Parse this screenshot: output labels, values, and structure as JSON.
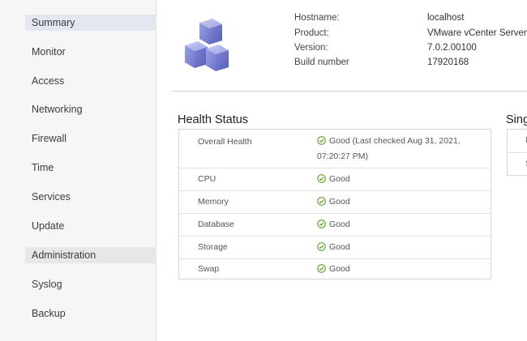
{
  "sidebar": {
    "items": [
      {
        "label": "Summary"
      },
      {
        "label": "Monitor"
      },
      {
        "label": "Access"
      },
      {
        "label": "Networking"
      },
      {
        "label": "Firewall"
      },
      {
        "label": "Time"
      },
      {
        "label": "Services"
      },
      {
        "label": "Update"
      },
      {
        "label": "Administration"
      },
      {
        "label": "Syslog"
      },
      {
        "label": "Backup"
      }
    ],
    "active": "Summary"
  },
  "summary": {
    "logo_icon": "vcenter-cubes-icon",
    "hostname_label": "Hostname:",
    "hostname_value": "localhost",
    "product_label": "Product:",
    "product_value": "VMware vCenter Server",
    "version_label": "Version:",
    "version_value": "7.0.2.00100",
    "build_label": "Build number",
    "build_value": "17920168"
  },
  "health": {
    "title": "Health Status",
    "status_icon": "check-circle-icon",
    "status_color": "#5aa220",
    "rows": [
      {
        "label": "Overall Health",
        "value_line1": "Good (Last checked Aug 31, 2021,",
        "value_line2": "07:20:27 PM)"
      },
      {
        "label": "CPU",
        "value": "Good"
      },
      {
        "label": "Memory",
        "value": "Good"
      },
      {
        "label": "Database",
        "value": "Good"
      },
      {
        "label": "Storage",
        "value": "Good"
      },
      {
        "label": "Swap",
        "value": "Good"
      }
    ]
  },
  "sso": {
    "title_partial": "Sing",
    "row1_partial": "I",
    "row2_partial": "S"
  },
  "colors": {
    "sidebar_bg": "#f6f6f6",
    "active_item_bg": "#e3e7ef",
    "group_item_bg": "#e7e7e7",
    "border": "#d7d7d7"
  }
}
